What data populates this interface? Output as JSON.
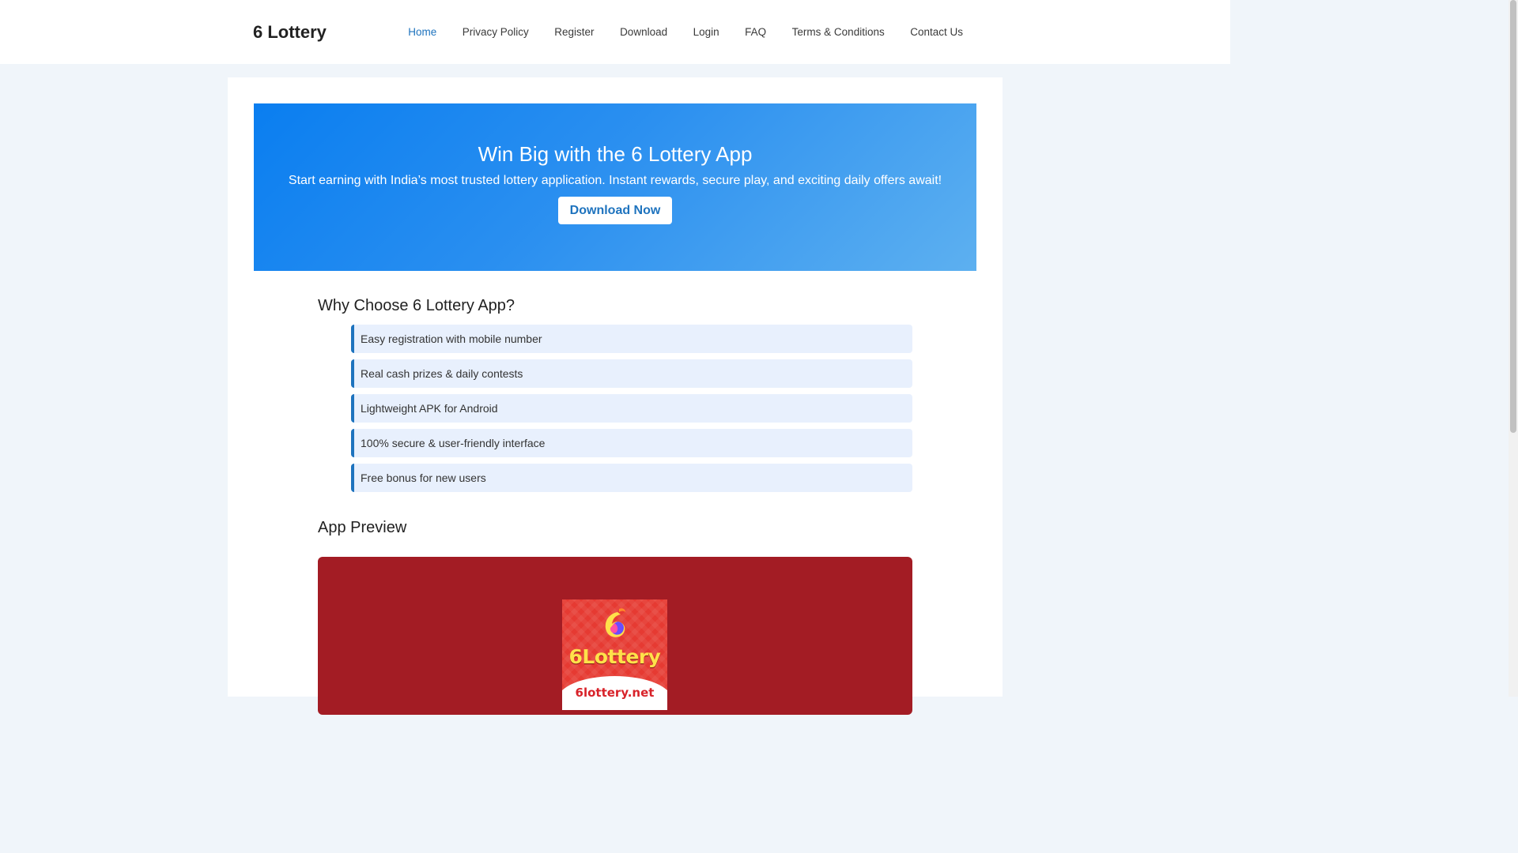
{
  "site": {
    "logo": "6 Lottery"
  },
  "nav": {
    "items": [
      {
        "label": "Home",
        "active": true
      },
      {
        "label": "Privacy Policy"
      },
      {
        "label": "Register"
      },
      {
        "label": "Download"
      },
      {
        "label": "Login"
      },
      {
        "label": "FAQ"
      },
      {
        "label": "Terms & Conditions"
      },
      {
        "label": "Contact Us"
      }
    ]
  },
  "hero": {
    "title": "Win Big with the 6 Lottery App",
    "subtitle": "Start earning with India’s most trusted lottery application. Instant rewards, secure play, and exciting daily offers await!",
    "button_label": "Download Now"
  },
  "why": {
    "title": "Why Choose 6 Lottery App?",
    "items": [
      "Easy registration with mobile number",
      "Real cash prizes & daily contests",
      "Lightweight APK for Android",
      "100% secure & user-friendly interface",
      "Free bonus for new users"
    ]
  },
  "preview": {
    "title": "App Preview",
    "app_icon_name": "6Lottery",
    "app_icon_domain": "6lottery.net"
  },
  "colors": {
    "accent": "#1e73be",
    "hero_start": "#0a7ef0",
    "hero_end": "#5db0f0",
    "feature_bg": "#e8f0fd",
    "preview_bg": "#a31c24"
  }
}
